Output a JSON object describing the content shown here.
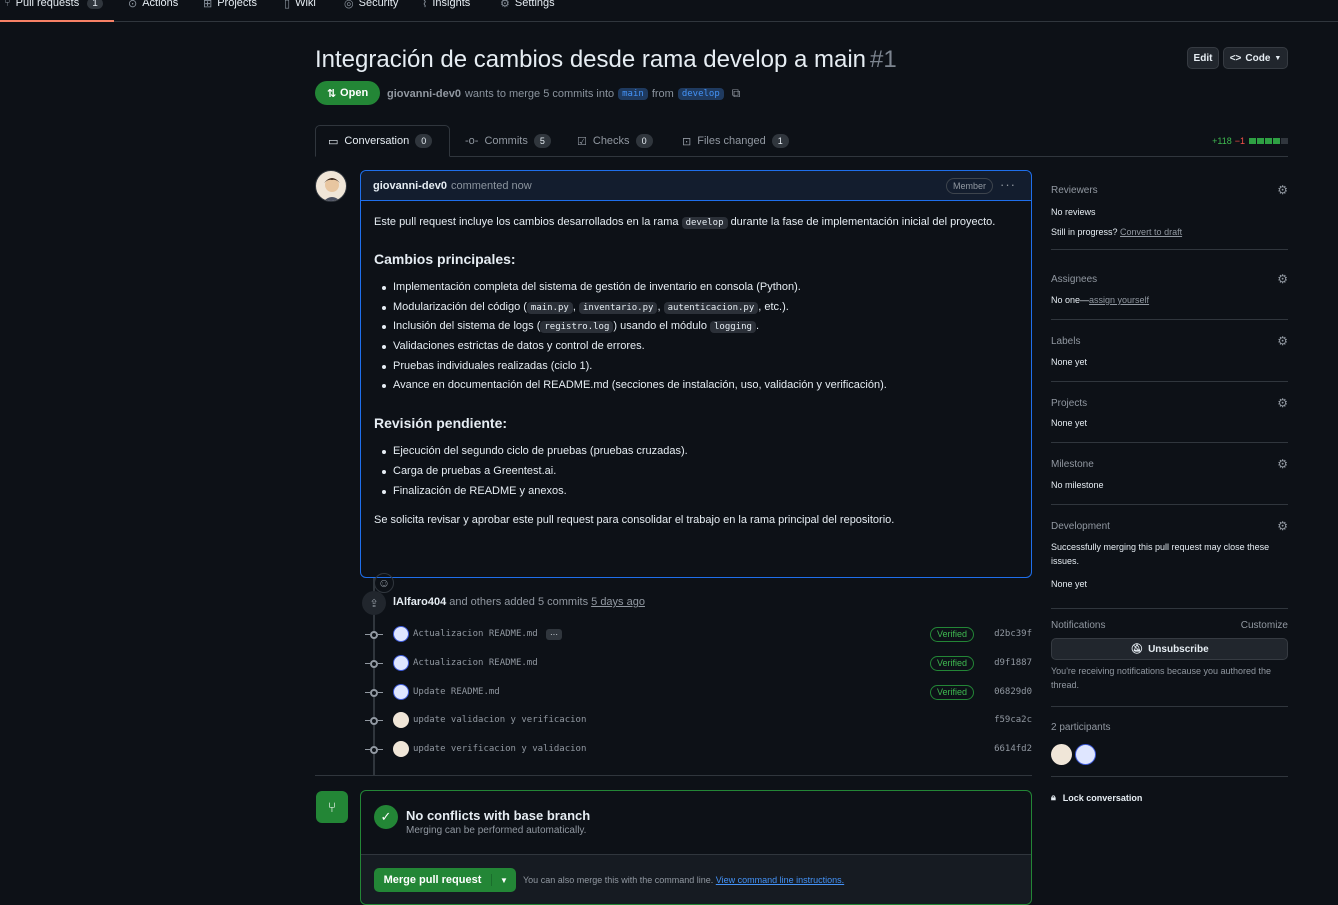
{
  "topnav": {
    "pull_requests": "Pull requests",
    "pull_requests_count": "1",
    "actions": "Actions",
    "projects": "Projects",
    "wiki": "Wiki",
    "security": "Security",
    "insights": "Insights",
    "settings": "Settings"
  },
  "header": {
    "title": "Integración de cambios desde rama develop a main",
    "number": "#1",
    "edit_label": "Edit",
    "code_label": "Code",
    "status": "Open",
    "author": "giovanni-dev0",
    "merge_text": "wants to merge 5 commits into",
    "base_branch": "main",
    "from_text": "from",
    "head_branch": "develop"
  },
  "tabs": [
    {
      "label": "Conversation",
      "count": "0"
    },
    {
      "label": "Commits",
      "count": "5"
    },
    {
      "label": "Checks",
      "count": "0"
    },
    {
      "label": "Files changed",
      "count": "1"
    }
  ],
  "diffstat": {
    "additions": "+118",
    "deletions": "−1"
  },
  "comment": {
    "author": "giovanni-dev0",
    "action": "commented now",
    "role": "Member",
    "intro_pre": "Este pull request incluye los cambios desarrollados en la rama",
    "intro_code": "develop",
    "intro_post": "durante la fase de implementación inicial del proyecto.",
    "heading1": "Cambios principales:",
    "item1": "Implementación completa del sistema de gestión de inventario en consola (Python).",
    "item2_pre": "Modularización del código (",
    "item2_code1": "main.py",
    "item2_code2": "inventario.py",
    "item2_code3": "autenticacion.py",
    "item2_post": ", etc.).",
    "item3_pre": "Inclusión del sistema de logs (",
    "item3_code1": "registro.log",
    "item3_mid": ") usando el módulo",
    "item3_code2": "logging",
    "item3_post": ".",
    "item4": "Validaciones estrictas de datos y control de errores.",
    "item5": "Pruebas individuales realizadas (ciclo 1).",
    "item6": "Avance en documentación del README.md (secciones de instalación, uso, validación y verificación).",
    "heading2": "Revisión pendiente:",
    "pending1": "Ejecución del segundo ciclo de pruebas (pruebas cruzadas).",
    "pending2": "Carga de pruebas a Greentest.ai.",
    "pending3": "Finalización de README y anexos.",
    "closing": "Se solicita revisar y aprobar este pull request para consolidar el trabajo en la rama principal del repositorio."
  },
  "push": {
    "author": "lAlfaro404",
    "text": "and others added 5 commits",
    "time": "5 days ago"
  },
  "commits": [
    {
      "message": "Actualizacion README.md",
      "verified": "Verified",
      "sha": "d2bc39f",
      "more": "···"
    },
    {
      "message": "Actualizacion README.md",
      "verified": "Verified",
      "sha": "d9f1887"
    },
    {
      "message": "Update README.md",
      "verified": "Verified",
      "sha": "06829d0"
    },
    {
      "message": "update validacion y verificacion",
      "sha": "f59ca2c"
    },
    {
      "message": "update verificacion y validacion",
      "sha": "6614fd2"
    }
  ],
  "merge": {
    "title": "No conflicts with base branch",
    "subtitle": "Merging can be performed automatically.",
    "button": "Merge pull request",
    "hint": "You can also merge this with the command line.",
    "hint_link": "View command line instructions."
  },
  "sidebar": {
    "reviewers": {
      "title": "Reviewers",
      "value": "No reviews",
      "draft_pre": "Still in progress?",
      "draft_link": "Convert to draft"
    },
    "assignees": {
      "title": "Assignees",
      "value_pre": "No one—",
      "value_link": "assign yourself"
    },
    "labels": {
      "title": "Labels",
      "value": "None yet"
    },
    "projects": {
      "title": "Projects",
      "value": "None yet"
    },
    "milestone": {
      "title": "Milestone",
      "value": "No milestone"
    },
    "development": {
      "title": "Development",
      "value1": "Successfully merging this pull request may close these",
      "value2": "issues.",
      "value3": "None yet"
    },
    "notifications": {
      "title": "Notifications",
      "customize": "Customize",
      "unsubscribe": "Unsubscribe",
      "note1": "You're receiving notifications because you authored the",
      "note2": "thread."
    },
    "participants": {
      "title": "2 participants"
    },
    "lock": "Lock conversation"
  }
}
